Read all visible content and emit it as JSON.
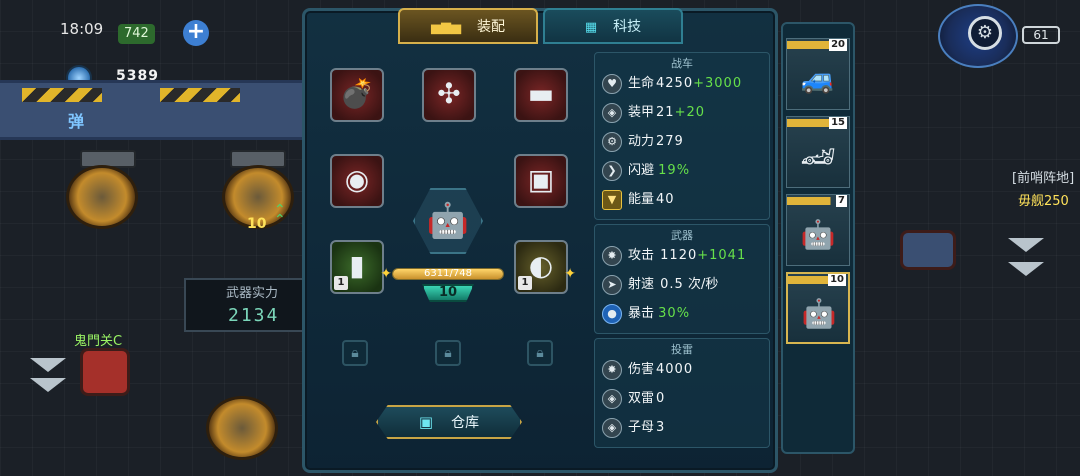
{
  "status": {
    "time": "18:09",
    "resource": "742",
    "battery": "61"
  },
  "hud": {
    "coins": "5389",
    "plus": "+",
    "bullet_tag": "弹",
    "gear_glyph": "⚙"
  },
  "scene": {
    "turret_level": "10",
    "weapon_power_label": "武器实力",
    "weapon_power_value": "2134",
    "enemy_name": "鬼門关C",
    "right_label_a": "[前哨阵地]",
    "right_label_b": "毋舰250"
  },
  "tabs": [
    {
      "label": "装配",
      "icon": "tank-icon",
      "active": true
    },
    {
      "label": "科技",
      "icon": "chip-icon",
      "active": false
    }
  ],
  "equipment": {
    "slots": [
      {
        "name": "bomb-slot",
        "glyph": "💣"
      },
      {
        "name": "propeller-slot",
        "glyph": "✣"
      },
      {
        "name": "cannon-slot",
        "glyph": "▬"
      },
      {
        "name": "shield-core-slot",
        "glyph": "◉"
      },
      {
        "name": "monitor-slot",
        "glyph": "▣"
      },
      {
        "name": "battery-slot",
        "glyph": "▮",
        "level": "1"
      },
      {
        "name": "mortar-slot",
        "glyph": "◐",
        "level": "1"
      }
    ],
    "exp_text": "6311/748",
    "exp_ratio": 1.0,
    "level": "10",
    "storage_label": "仓库",
    "storage_icon": "▣"
  },
  "stats": {
    "vehicle_title": "战车",
    "vehicle": [
      {
        "icon": "♥",
        "label": "生命",
        "value": "4250",
        "bonus": "+3000"
      },
      {
        "icon": "◈",
        "label": "装甲",
        "value": "21",
        "bonus": "+20"
      },
      {
        "icon": "⚙",
        "label": "动力",
        "value": "279",
        "bonus": ""
      },
      {
        "icon": "❯",
        "label": "闪避",
        "value": "",
        "bonus": "19%"
      },
      {
        "icon": "▼",
        "label": "能量",
        "value": "40",
        "bonus": ""
      }
    ],
    "weapon_title": "武器",
    "weapon": [
      {
        "icon": "✸",
        "label": "攻击",
        "value": "1120",
        "bonus": "+1041"
      },
      {
        "icon": "➤",
        "label": "射速",
        "value": "0.5",
        "unit": "次/秒",
        "bonus": ""
      },
      {
        "icon": "●",
        "label": "暴击",
        "value": "",
        "bonus": "30%"
      }
    ],
    "mine_title": "投雷",
    "mine": [
      {
        "icon": "✸",
        "label": "伤害",
        "value": "4000",
        "bonus": ""
      },
      {
        "icon": "◈",
        "label": "双雷",
        "value": "0",
        "bonus": ""
      },
      {
        "icon": "◈",
        "label": "子母",
        "value": "3",
        "bonus": ""
      }
    ]
  },
  "vehicles": [
    {
      "level": "20",
      "glyph": "🚙"
    },
    {
      "level": "15",
      "glyph": "🏎"
    },
    {
      "level": "7",
      "glyph": "🤖"
    },
    {
      "level": "10",
      "glyph": "🤖",
      "active": true
    }
  ]
}
